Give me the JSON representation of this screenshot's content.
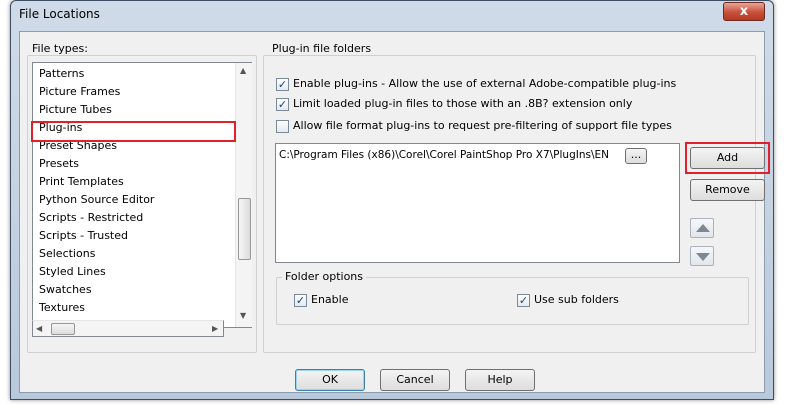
{
  "window": {
    "title": "File Locations",
    "close_label": "x"
  },
  "file_types": {
    "label": "File types:",
    "items": [
      "Patterns",
      "Picture Frames",
      "Picture Tubes",
      "Plug-ins",
      "Preset Shapes",
      "Presets",
      "Print Templates",
      "Python Source Editor",
      "Scripts - Restricted",
      "Scripts - Trusted",
      "Selections",
      "Styled Lines",
      "Swatches",
      "Textures"
    ],
    "selected": "Plug-ins"
  },
  "plugin_folders": {
    "label": "Plug-in file folders",
    "enable_plugins": {
      "label": "Enable plug-ins - Allow the use of external Adobe-compatible plug-ins",
      "checked": true
    },
    "limit_loaded": {
      "label": "Limit loaded plug-in files to those with an .8B? extension only",
      "checked": true
    },
    "allow_prefilter": {
      "label": "Allow file format plug-ins to request pre-filtering of support file types",
      "checked": false
    },
    "folder_path": "C:\\Program Files (x86)\\Corel\\Corel PaintShop Pro X7\\PlugIns\\EN",
    "browse_label": "...",
    "add_label": "Add",
    "remove_label": "Remove"
  },
  "folder_options": {
    "label": "Folder options",
    "enable": {
      "label": "Enable",
      "checked": true
    },
    "use_sub_folders": {
      "label": "Use sub folders",
      "checked": true
    }
  },
  "footer": {
    "ok_label": "OK",
    "cancel_label": "Cancel",
    "help_label": "Help"
  },
  "colors": {
    "highlight": "#e0202a",
    "check": "#223e6e"
  }
}
